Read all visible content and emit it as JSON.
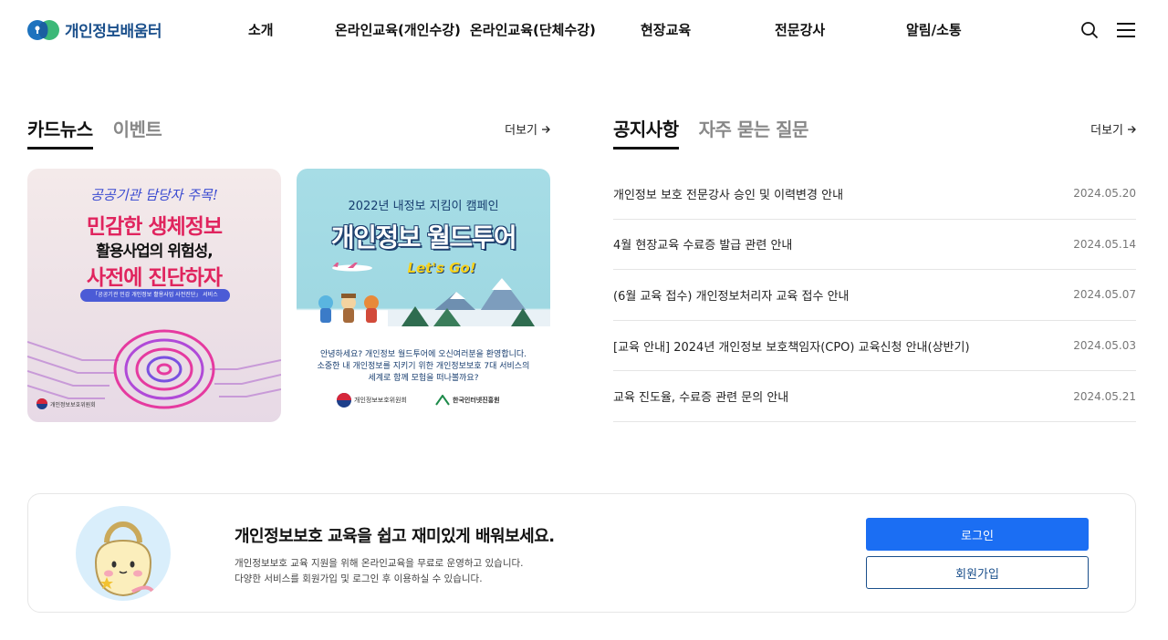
{
  "header": {
    "logo_text": "개인정보배움터",
    "nav": [
      {
        "label": "소개"
      },
      {
        "label": "온라인교육(개인수강)"
      },
      {
        "label": "온라인교육(단체수강)"
      },
      {
        "label": "현장교육"
      },
      {
        "label": "전문강사"
      },
      {
        "label": "알림/소통"
      }
    ],
    "icons": [
      "search-icon",
      "menu-icon"
    ]
  },
  "card_section": {
    "tabs": [
      {
        "label": "카드뉴스"
      },
      {
        "label": "이벤트"
      }
    ],
    "more_label": "더보기",
    "cards": [
      {
        "line1": "공공기관 담당자 주목!",
        "line2": "민감한 생체정보",
        "line3": "활용사업의 위험성,",
        "line4": "사전에 진단하자",
        "tag": "「공공기관 민감 개인정보 활용사업 사전진단」 서비스",
        "footer": "개인정보보호위원회"
      },
      {
        "line1": "2022년 내정보 지킴이 캠페인",
        "line2": "개인정보 월드투어",
        "line3": "Let's Go!",
        "desc1": "안녕하세요? 개인정보 월드투어에 오신여러분을 환영합니다.",
        "desc2": "소중한 내 개인정보를 지키기 위한 개인정보보호 7대 서비스의",
        "desc3": "세계로 함께 모험을 떠나볼까요?",
        "footer1": "개인정보보호위원회",
        "footer2": "한국인터넷진흥원"
      }
    ]
  },
  "notice_section": {
    "tabs": [
      {
        "label": "공지사항"
      },
      {
        "label": "자주 묻는 질문"
      }
    ],
    "more_label": "더보기",
    "items": [
      {
        "title": "개인정보 보호 전문강사 승인 및 이력변경 안내",
        "date": "2024.05.20"
      },
      {
        "title": "4월 현장교육 수료증 발급 관련 안내",
        "date": "2024.05.14"
      },
      {
        "title": "(6월 교육 접수) 개인정보처리자 교육 접수 안내",
        "date": "2024.05.07"
      },
      {
        "title": "[교육 안내] 2024년 개인정보 보호책임자(CPO) 교육신청 안내(상반기)",
        "date": "2024.05.03"
      },
      {
        "title": "교육 진도율, 수료증 관련 문의 안내",
        "date": "2024.05.21"
      }
    ]
  },
  "banner": {
    "title": "개인정보보호 교육을 쉽고 재미있게 배워보세요.",
    "desc1": "개인정보보호 교육 지원을 위해 온라인교육을 무료로 운영하고 있습니다.",
    "desc2": "다양한 서비스를 회원가입 및 로그인 후 이용하실 수 있습니다.",
    "login_label": "로그인",
    "join_label": "회원가입"
  },
  "colors": {
    "brand": "#1a4f8b",
    "primary_button": "#1b6ef3",
    "logo_green": "#3cb878"
  }
}
